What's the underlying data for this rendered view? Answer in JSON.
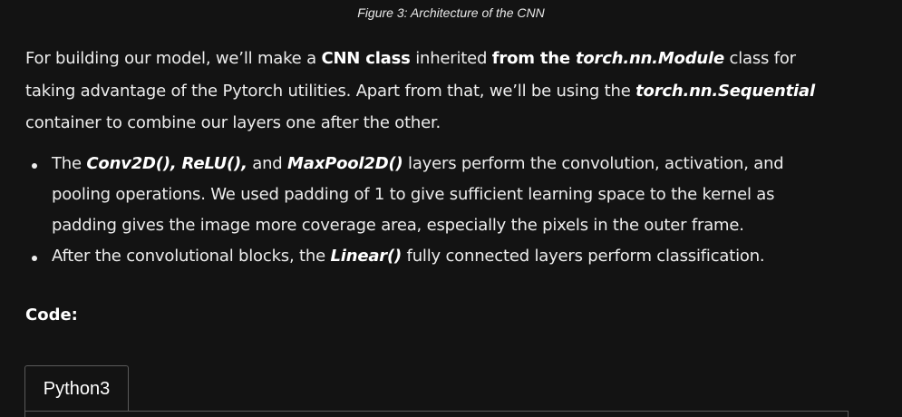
{
  "caption": "Figure 3: Architecture of the CNN",
  "intro": {
    "t1": "For building our model, we’ll make a ",
    "b1": "CNN class",
    "t2": " inherited ",
    "b2": "from the ",
    "i1": "torch.nn.Module",
    "t3": " class for taking advantage of the Pytorch utilities. Apart from that, we’ll be using the ",
    "i2": "torch.nn.Sequential",
    "t4": " container to combine our layers one after the other."
  },
  "bullets": [
    {
      "t1": "The ",
      "i1": "Conv2D(), ReLU(),",
      "t2": " and ",
      "i2": "MaxPool2D()",
      "t3": " layers perform the convolution, activation, and pooling operations. We used padding of 1 to give sufficient learning space to the kernel as padding gives the image more coverage area, especially the pixels in the outer frame."
    },
    {
      "t1": "After the convolutional blocks, the ",
      "i1": "Linear()",
      "t2": " fully connected layers perform classification."
    }
  ],
  "code_heading": "Code:",
  "code_tab": "Python3"
}
